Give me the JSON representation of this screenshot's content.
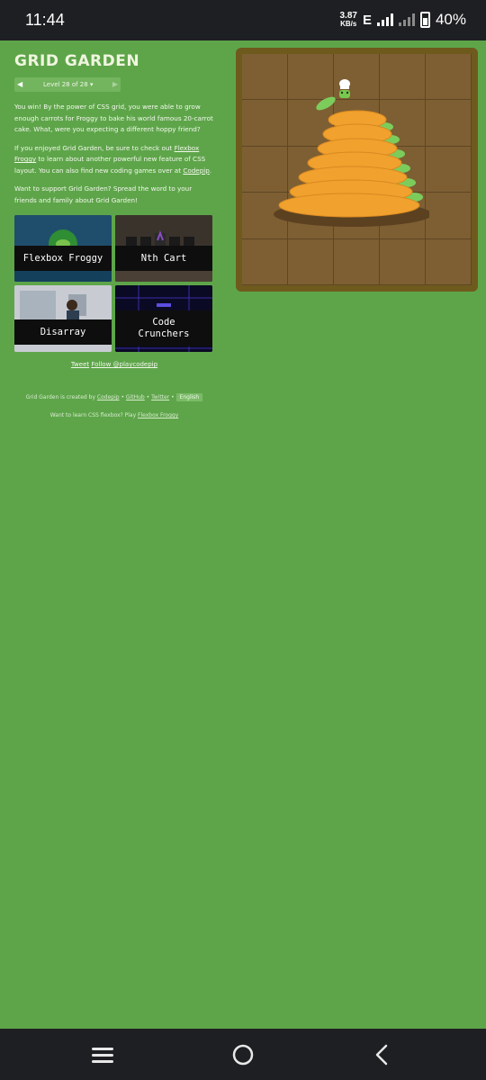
{
  "status_bar": {
    "time": "11:44",
    "speed_value": "3.87",
    "speed_unit": "KB/s",
    "network": "E",
    "battery": "40%"
  },
  "page": {
    "title": "GRID GARDEN",
    "level_label": "Level 28 of 28 ▾",
    "win_text": "You win! By the power of CSS grid, you were able to grow enough carrots for Froggy to bake his world famous 20-carrot cake. What, were you expecting a different hoppy friend?",
    "enjoy_text_1": "If you enjoyed Grid Garden, be sure to check out ",
    "enjoy_link_1": "Flexbox Froggy",
    "enjoy_text_2": " to learn about another powerful new feature of CSS layout. You can also find new coding games over at ",
    "enjoy_link_2": "Codepip",
    "enjoy_text_3": ".",
    "support_text": "Want to support Grid Garden? Spread the word to your friends and family about Grid Garden!",
    "games": [
      {
        "name": "Flexbox Froggy"
      },
      {
        "name": "Nth Cart"
      },
      {
        "name": "Disarray"
      },
      {
        "name": "Code\nCrunchers"
      }
    ],
    "tweet": "Tweet",
    "follow": "Follow @playcodepip",
    "credits_prefix": "Grid Garden is created by ",
    "credits_codepip": "Codepip",
    "credits_github": "GitHub",
    "credits_twitter": "Twitter",
    "credits_sep": " • ",
    "language": "English",
    "flexbox_prefix": "Want to learn CSS flexbox? Play ",
    "flexbox_link": "Flexbox Froggy"
  },
  "colors": {
    "background": "#5ea54a",
    "garden_soil": "#7d5f33",
    "garden_frame": "#6f5a1e",
    "carrot": "#f0a12e",
    "leaf": "#7ccc5c"
  }
}
